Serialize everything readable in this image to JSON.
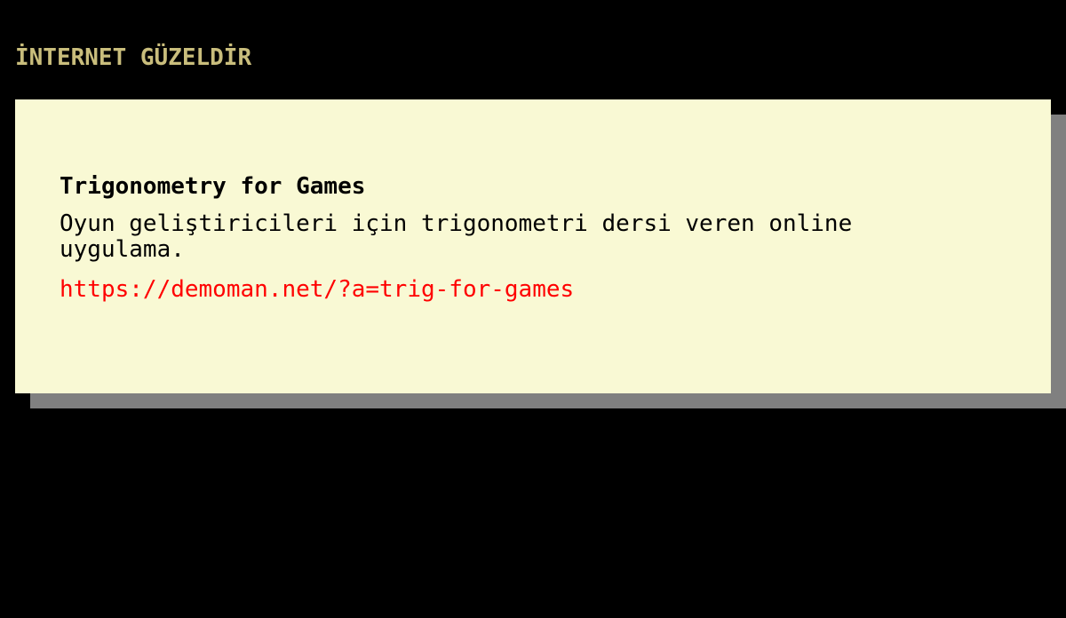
{
  "colors": {
    "background": "#000000",
    "title": "#c9bd7c",
    "card_background": "#f9f9d4",
    "card_shadow": "#808080",
    "link": "#ff0000",
    "text": "#000000"
  },
  "header": {
    "title": "İNTERNET GÜZELDİR"
  },
  "card": {
    "title": "Trigonometry for Games",
    "description": "Oyun geliştiricileri için trigonometri dersi veren online uygulama.",
    "link": "https://demoman.net/?a=trig-for-games"
  }
}
